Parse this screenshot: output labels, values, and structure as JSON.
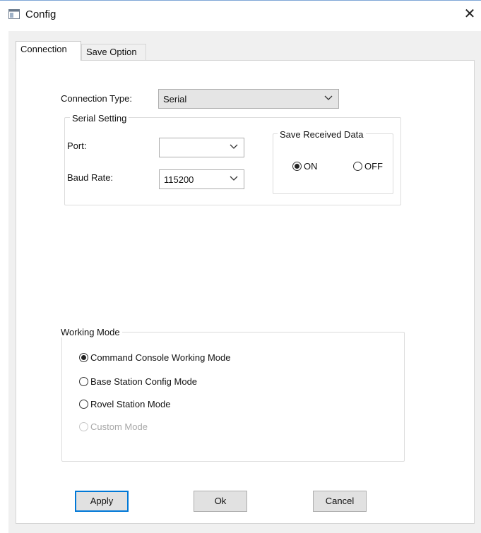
{
  "window": {
    "title": "Config",
    "close_icon": "close-icon",
    "app_icon": "window-icon"
  },
  "tabs": [
    {
      "label": "Connection",
      "active": true
    },
    {
      "label": "Save Option",
      "active": false
    }
  ],
  "connection": {
    "type_label": "Connection Type:",
    "type_value": "Serial"
  },
  "serial_setting": {
    "caption": "Serial Setting",
    "port_label": "Port:",
    "port_value": "",
    "baud_label": "Baud Rate:",
    "baud_value": "115200"
  },
  "save_received": {
    "caption": "Save Received Data",
    "on_label": "ON",
    "off_label": "OFF",
    "selected": "ON"
  },
  "working_mode": {
    "caption": "Working Mode",
    "options": [
      {
        "label": "Command Console Working Mode",
        "selected": true,
        "enabled": true
      },
      {
        "label": "Base Station Config Mode",
        "selected": false,
        "enabled": true
      },
      {
        "label": "Rovel Station Mode",
        "selected": false,
        "enabled": true
      },
      {
        "label": "Custom Mode",
        "selected": false,
        "enabled": false
      }
    ]
  },
  "buttons": {
    "apply": "Apply",
    "ok": "Ok",
    "cancel": "Cancel"
  },
  "colors": {
    "focus_border": "#0078d7",
    "client_bg": "#f0f0f0"
  }
}
